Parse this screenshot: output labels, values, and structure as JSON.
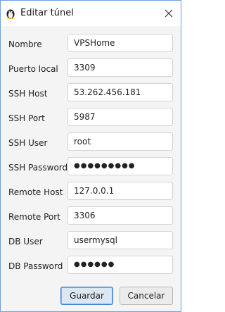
{
  "window": {
    "title": "Editar túnel"
  },
  "form": {
    "fields": [
      {
        "label": "Nombre",
        "value": "VPSHome"
      },
      {
        "label": "Puerto local",
        "value": "3309"
      },
      {
        "label": "SSH Host",
        "value": "53.262.456.181"
      },
      {
        "label": "SSH Port",
        "value": "5987"
      },
      {
        "label": "SSH User",
        "value": "root"
      },
      {
        "label": "SSH Password",
        "value": "●●●●●●●●●"
      },
      {
        "label": "Remote Host",
        "value": "127.0.0.1"
      },
      {
        "label": "Remote Port",
        "value": "3306"
      },
      {
        "label": "DB User",
        "value": "usermysql"
      },
      {
        "label": "DB Password",
        "value": "●●●●●●"
      }
    ]
  },
  "buttons": {
    "save_label": "Guardar",
    "cancel_label": "Cancelar"
  },
  "icons": {
    "app": "penguin-icon",
    "close": "close-icon"
  },
  "colors": {
    "accent": "#3c7fd1",
    "window_border": "#6fa0d8"
  }
}
